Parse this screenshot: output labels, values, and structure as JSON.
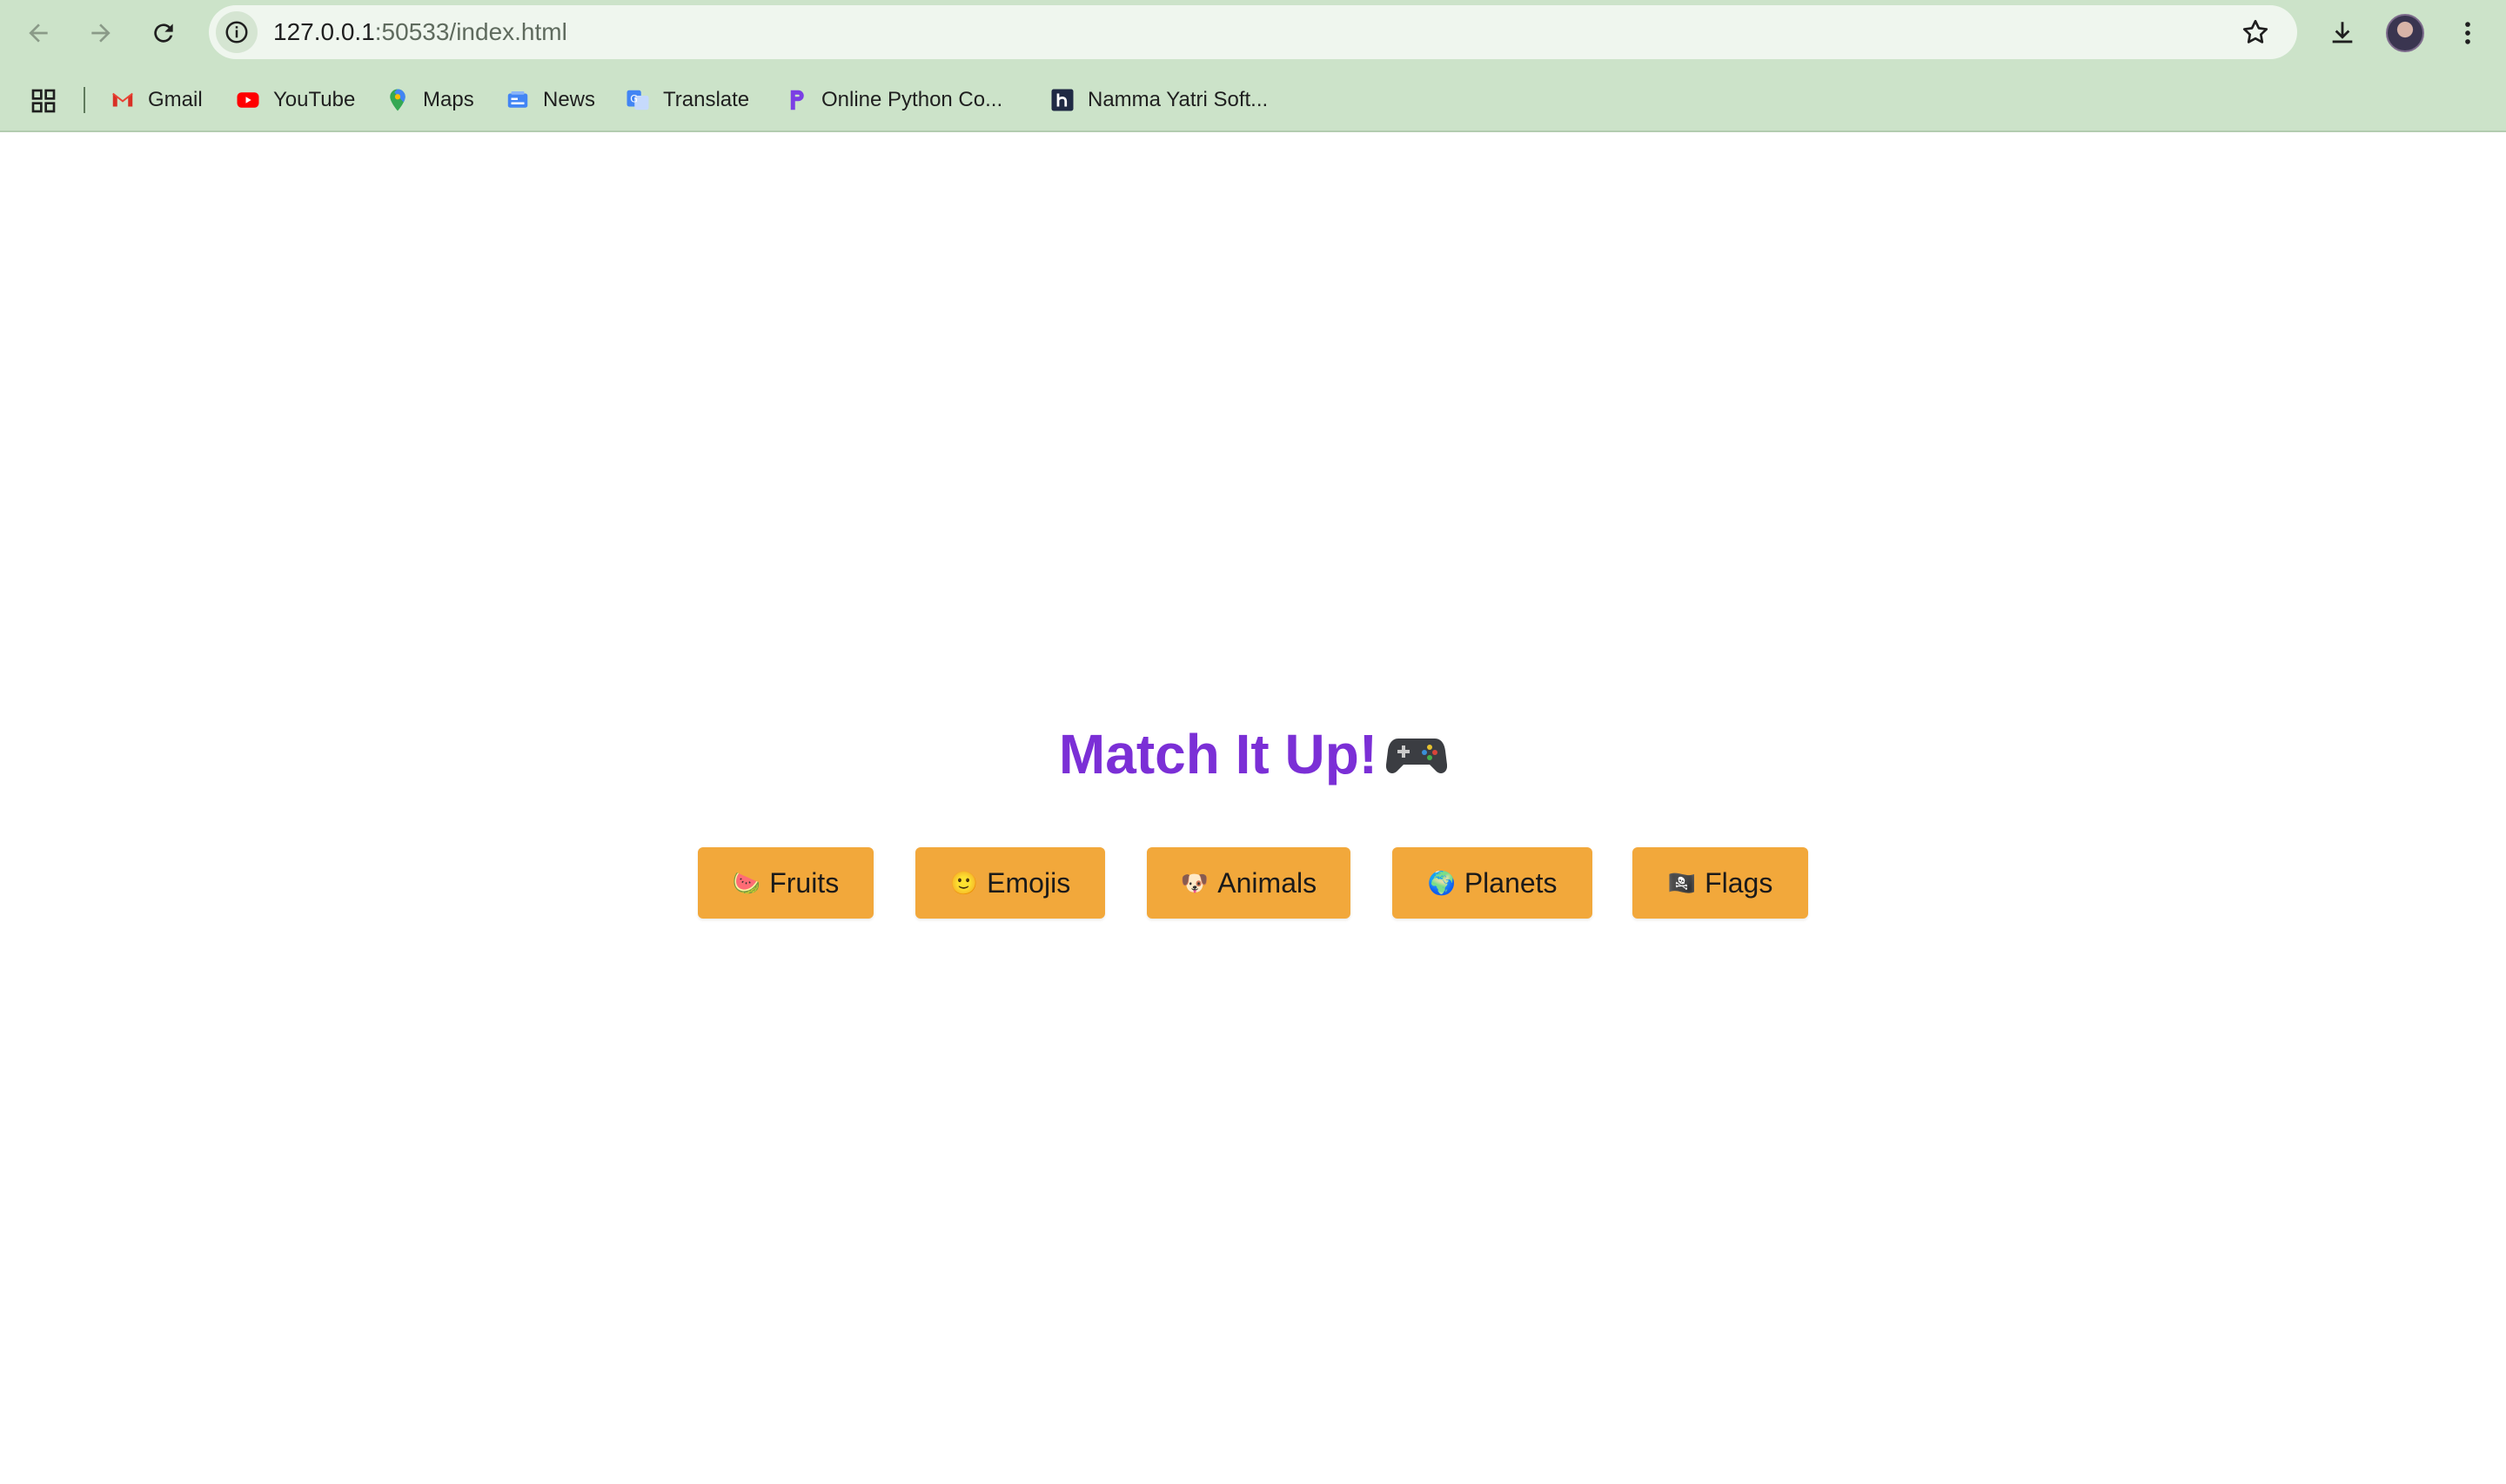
{
  "browser": {
    "url_host": "127.0.0.1",
    "url_path": ":50533/index.html",
    "bookmarks": [
      {
        "label": "Gmail",
        "icon": "gmail-icon"
      },
      {
        "label": "YouTube",
        "icon": "youtube-icon"
      },
      {
        "label": "Maps",
        "icon": "maps-icon"
      },
      {
        "label": "News",
        "icon": "news-icon"
      },
      {
        "label": "Translate",
        "icon": "translate-icon"
      },
      {
        "label": "Online Python Co...",
        "icon": "python-compiler-icon"
      },
      {
        "label": "Namma Yatri Soft...",
        "icon": "namma-yatri-icon"
      }
    ]
  },
  "page": {
    "title": "Match It Up!",
    "title_icon": "🎮",
    "categories": [
      {
        "icon": "🍉",
        "label": "Fruits"
      },
      {
        "icon": "🙂",
        "label": "Emojis"
      },
      {
        "icon": "🐶",
        "label": "Animals"
      },
      {
        "icon": "🌍",
        "label": "Planets"
      },
      {
        "icon": "🏴‍☠️",
        "label": "Flags"
      }
    ]
  },
  "colors": {
    "title": "#7b2fd6",
    "button": "#f2a83b",
    "chrome": "#cce3c9"
  }
}
